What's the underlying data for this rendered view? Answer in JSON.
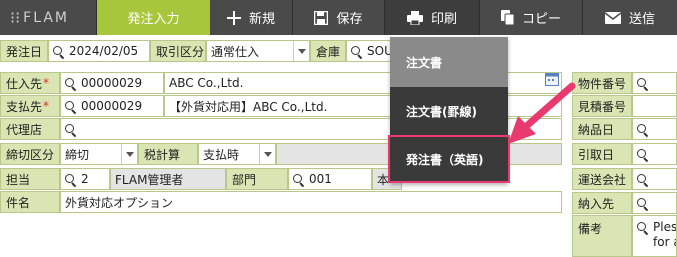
{
  "header": {
    "logo": "FLAM",
    "active_tab": "発注入力",
    "new_label": "新規",
    "save_label": "保存",
    "print_label": "印刷",
    "copy_label": "コピー",
    "send_label": "送信"
  },
  "form": {
    "order_date_label": "発注日",
    "order_date": "2024/02/05",
    "trade_type_label": "取引区分",
    "trade_type": "通常仕入",
    "warehouse_label": "倉庫",
    "warehouse": "SOU",
    "supplier_label": "仕入先",
    "supplier_code": "00000029",
    "supplier_name": "ABC Co.,Ltd.",
    "payee_label": "支払先",
    "payee_code": "00000029",
    "payee_name": "【外貨対応用】ABC Co.,Ltd.",
    "agent_label": "代理店",
    "closing_label": "締切区分",
    "closing_value": "締切",
    "tax_label": "税計算",
    "tax_value": "支払時",
    "person_label": "担当",
    "person_code": "2",
    "person_name": "FLAM管理者",
    "dept_label": "部門",
    "dept_code": "001",
    "dept_name_partial": "本",
    "subject_label": "件名",
    "subject": "外貨対応オプション"
  },
  "right_panel": {
    "item_no_label": "物件番号",
    "quote_no_label": "見積番号",
    "delivery_date_label": "納品日",
    "pickup_date_label": "引取日",
    "carrier_label": "運送会社",
    "ship_to_label": "納入先",
    "remarks_label": "備考",
    "remarks_line1": "Ples",
    "remarks_line2": "for a"
  },
  "print_menu": {
    "items": [
      "注文書",
      "注文書(罫線)",
      "発注書（英語)"
    ]
  },
  "colors": {
    "toolbar": "#4a4a4a",
    "accent": "#a8c63b",
    "label_bg": "#d9e6b3",
    "highlight": "#e83a6e"
  }
}
